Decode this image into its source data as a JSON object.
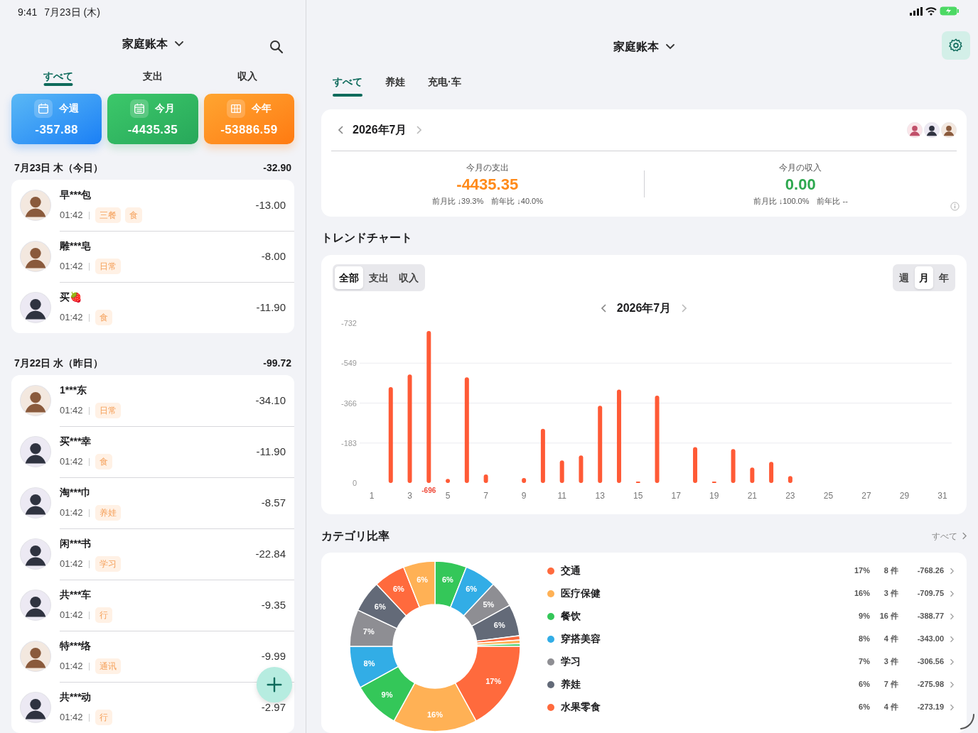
{
  "status_bar": {
    "time": "9:41",
    "date": "7月23日 (木)"
  },
  "left": {
    "title": "家庭账本",
    "tabs": [
      {
        "label": "すべて",
        "selected": true
      },
      {
        "label": "支出",
        "selected": false
      },
      {
        "label": "収入",
        "selected": false
      }
    ],
    "summary": [
      {
        "kind": "week",
        "label": "今週",
        "amount": "-357.88"
      },
      {
        "kind": "month",
        "label": "今月",
        "amount": "-4435.35"
      },
      {
        "kind": "year",
        "label": "今年",
        "amount": "-53886.59"
      }
    ],
    "groups": [
      {
        "date": "7月23日 木（今日）",
        "total": "-32.90",
        "items": [
          {
            "name": "早***包",
            "time": "01:42",
            "tags": [
              "三餐",
              "食"
            ],
            "amount": "-13.00",
            "kind": "man"
          },
          {
            "name": "雕***皂",
            "time": "01:42",
            "tags": [
              "日常"
            ],
            "amount": "-8.00",
            "kind": "man"
          },
          {
            "name": "买🍓",
            "time": "01:42",
            "tags": [
              "食"
            ],
            "amount": "-11.90",
            "kind": "woman"
          }
        ]
      },
      {
        "date": "7月22日 水（昨日）",
        "total": "-99.72",
        "items": [
          {
            "name": "1***东",
            "time": "01:42",
            "tags": [
              "日常"
            ],
            "amount": "-34.10",
            "kind": "man"
          },
          {
            "name": "买***幸",
            "time": "01:42",
            "tags": [
              "食"
            ],
            "amount": "-11.90",
            "kind": "woman"
          },
          {
            "name": "淘***巾",
            "time": "01:42",
            "tags": [
              "养娃"
            ],
            "amount": "-8.57",
            "kind": "woman"
          },
          {
            "name": "闲***书",
            "time": "01:42",
            "tags": [
              "学习"
            ],
            "amount": "-22.84",
            "kind": "woman"
          },
          {
            "name": "共***车",
            "time": "01:42",
            "tags": [
              "行"
            ],
            "amount": "-9.35",
            "kind": "woman"
          },
          {
            "name": "特***络",
            "time": "01:42",
            "tags": [
              "通讯"
            ],
            "amount": "-9.99",
            "kind": "man"
          },
          {
            "name": "共***动",
            "time": "01:42",
            "tags": [
              "行"
            ],
            "amount": "-2.97",
            "kind": "woman"
          }
        ]
      }
    ]
  },
  "right": {
    "title": "家庭账本",
    "tabs": [
      {
        "label": "すべて",
        "selected": true
      },
      {
        "label": "养娃",
        "selected": false
      },
      {
        "label": "充电·车",
        "selected": false
      }
    ],
    "month_card": {
      "month": "2026年7月",
      "members": [
        {
          "kind": "girl"
        },
        {
          "kind": "woman"
        },
        {
          "kind": "man"
        }
      ],
      "stats": [
        {
          "kind": "expense",
          "label": "今月の支出",
          "value": "-4435.35",
          "compare": "前月比 ↓39.3%　前年比 ↓40.0%"
        },
        {
          "kind": "income",
          "label": "今月の収入",
          "value": "0.00",
          "compare": "前月比 ↓100.0%　前年比 --"
        }
      ]
    },
    "trend": {
      "title": "トレンドチャート",
      "type_tabs": [
        {
          "label": "全部",
          "selected": true
        },
        {
          "label": "支出",
          "selected": false
        },
        {
          "label": "収入",
          "selected": false
        }
      ],
      "period_tabs": [
        {
          "label": "週",
          "selected": false
        },
        {
          "label": "月",
          "selected": true
        },
        {
          "label": "年",
          "selected": false
        }
      ],
      "month": "2026年7月",
      "chart_data": {
        "type": "bar",
        "x": [
          2,
          3,
          4,
          5,
          6,
          7,
          9,
          10,
          11,
          12,
          13,
          14,
          15,
          16,
          18,
          19,
          20,
          21,
          22,
          23
        ],
        "series": [
          {
            "color": "#ff5a36",
            "values": [
              -439,
              -497,
              -696,
              -19,
              -484,
              -39,
              -23,
              -248,
              -103,
              -126,
              -354,
              -428,
              -6,
              -400,
              -164,
              -6,
              -155,
              -71,
              -97,
              -32
            ]
          }
        ],
        "xlim": [
          1,
          31
        ],
        "ylim": [
          0,
          -732
        ],
        "grid": true,
        "yticks": [
          {
            "value": 0,
            "label": "0"
          },
          {
            "value": -183,
            "label": "-183"
          },
          {
            "value": -366,
            "label": "-366"
          },
          {
            "value": -549,
            "label": "-549"
          },
          {
            "value": -732,
            "label": "-732"
          }
        ],
        "xticks": [
          1,
          3,
          5,
          7,
          9,
          11,
          13,
          15,
          17,
          19,
          21,
          23,
          25,
          27,
          29,
          31
        ],
        "annotations": [
          {
            "x": 4,
            "y": 0,
            "text": "-696"
          }
        ]
      }
    },
    "categories": {
      "title": "カテゴリ比率",
      "more": "すべて",
      "chart_data": {
        "type": "donut",
        "values": [
          6,
          6,
          5,
          6,
          0.8,
          0.7,
          0.5,
          17,
          16,
          9,
          8,
          7,
          6,
          6,
          6
        ],
        "colors": [
          "#34c759",
          "#32ade6",
          "#8e8e93",
          "#636a78",
          "#ff6a3d",
          "#ffb155",
          "#34c759",
          "#ff6a3d",
          "#ffb155",
          "#34c759",
          "#32ade6",
          "#8e8e93",
          "#636a78",
          "#ff6a3d",
          "#ffb155"
        ],
        "value_labels": [
          "6%",
          "6%",
          "5%",
          "6%",
          null,
          null,
          null,
          "17%",
          "16%",
          "9%",
          "8%",
          "7%",
          "6%",
          "6%",
          "6%"
        ]
      },
      "items": [
        {
          "name": "交通",
          "color": "#ff6a3d",
          "percent": "17%",
          "count": "8 件",
          "amount": "-768.26"
        },
        {
          "name": "医疗保健",
          "color": "#ffb155",
          "percent": "16%",
          "count": "3 件",
          "amount": "-709.75"
        },
        {
          "name": "餐饮",
          "color": "#34c759",
          "percent": "9%",
          "count": "16 件",
          "amount": "-388.77"
        },
        {
          "name": "穿搭美容",
          "color": "#32ade6",
          "percent": "8%",
          "count": "4 件",
          "amount": "-343.00"
        },
        {
          "name": "学习",
          "color": "#8e8e93",
          "percent": "7%",
          "count": "3 件",
          "amount": "-306.56"
        },
        {
          "name": "养娃",
          "color": "#636a78",
          "percent": "6%",
          "count": "7 件",
          "amount": "-275.98"
        },
        {
          "name": "水果零食",
          "color": "#ff6a3d",
          "percent": "6%",
          "count": "4 件",
          "amount": "-273.19"
        }
      ]
    }
  }
}
